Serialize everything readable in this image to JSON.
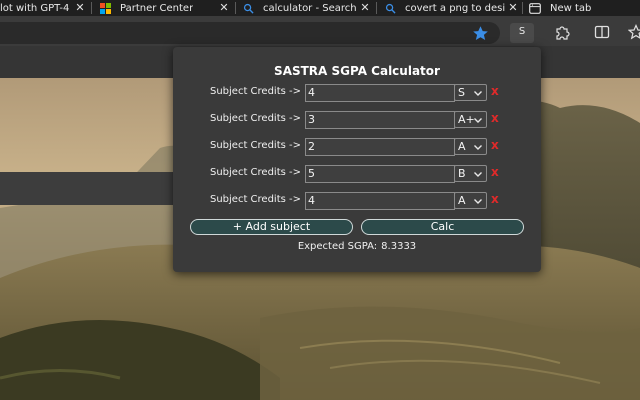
{
  "tabs": [
    {
      "title": "lot with GPT-4",
      "icon": "chat-icon"
    },
    {
      "title": "Partner Center",
      "icon": "microsoft-logo-icon"
    },
    {
      "title": "calculator - Search",
      "icon": "search-icon"
    },
    {
      "title": "covert a png to desi",
      "icon": "search-icon"
    },
    {
      "title": "New tab",
      "icon": "new-tab-icon"
    }
  ],
  "toolbar": {
    "extension_label": "S",
    "favorite_color": "#3b8ee6"
  },
  "popup": {
    "title": "SASTRA SGPA Calculator",
    "rows": [
      {
        "label": "Subject Credits ->",
        "credits": "4",
        "grade": "S",
        "remove": "x"
      },
      {
        "label": "Subject Credits ->",
        "credits": "3",
        "grade": "A+",
        "remove": "x"
      },
      {
        "label": "Subject Credits ->",
        "credits": "2",
        "grade": "A",
        "remove": "x"
      },
      {
        "label": "Subject Credits ->",
        "credits": "5",
        "grade": "B",
        "remove": "x"
      },
      {
        "label": "Subject Credits ->",
        "credits": "4",
        "grade": "A",
        "remove": "x"
      }
    ],
    "add_button": "+ Add subject",
    "calc_button": "Calc",
    "result_label": "Expected SGPA:",
    "result_value": "8.3333"
  },
  "colors": {
    "remove_red": "#e02a2a",
    "button_fill": "#2c4a4a",
    "popup_bg": "#3a3a3a"
  }
}
